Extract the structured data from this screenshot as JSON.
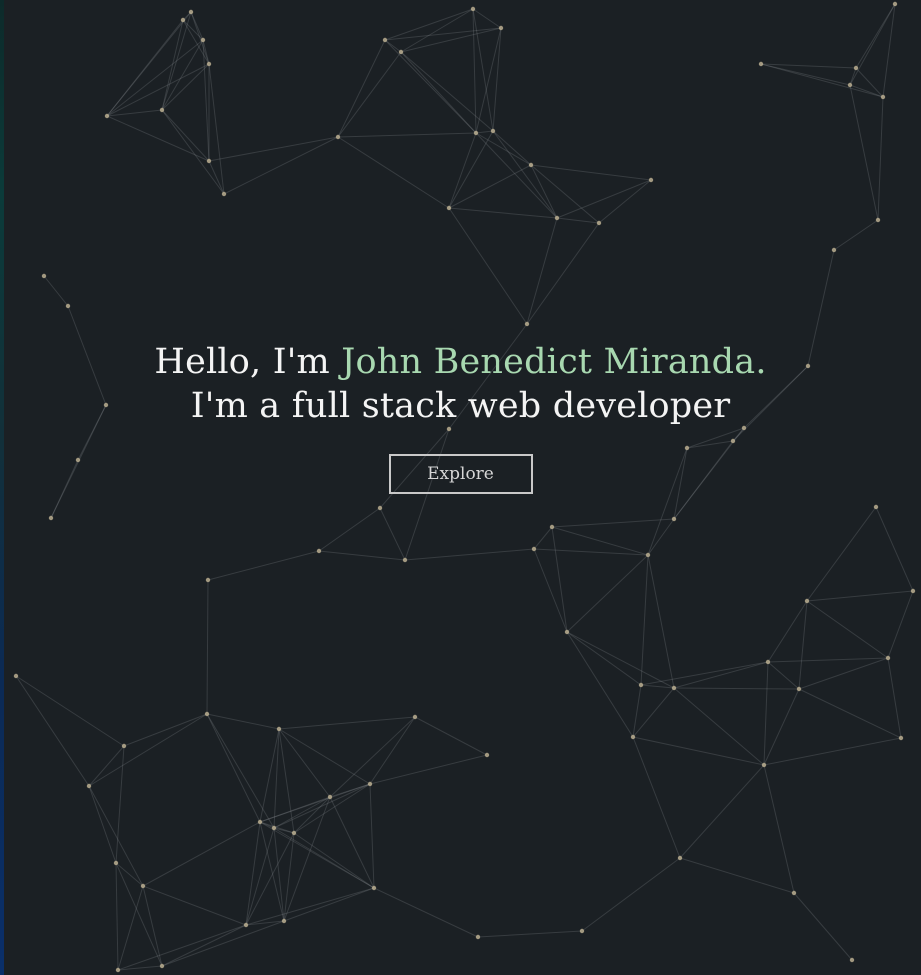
{
  "hero": {
    "greeting_prefix": "Hello, I'm ",
    "name": "John Benedict Miranda.",
    "tagline": "I'm a full stack web developer"
  },
  "actions": {
    "explore_label": "Explore"
  },
  "colors": {
    "background": "#1b2024",
    "accent_name": "#a8d8b0",
    "text": "#f4f4f4",
    "node": "#b9ad8f"
  }
}
